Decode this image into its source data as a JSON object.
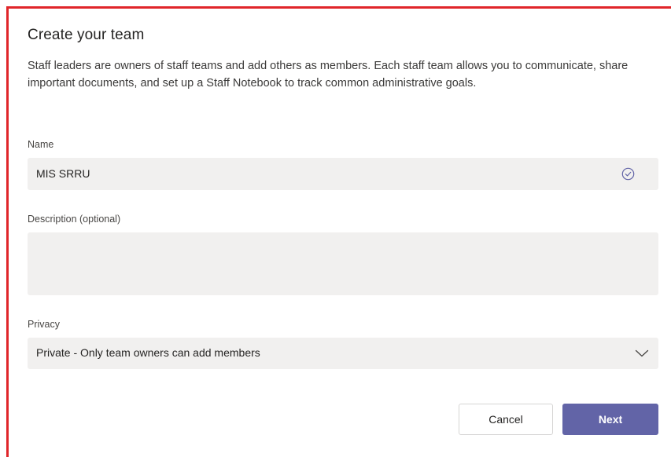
{
  "dialog": {
    "title": "Create your team",
    "description": "Staff leaders are owners of staff teams and add others as members. Each staff team allows you to communicate, share important documents, and set up a Staff Notebook to track common administrative goals."
  },
  "name_field": {
    "label": "Name",
    "value": "MIS SRRU",
    "status_icon": "check-circle-icon"
  },
  "description_field": {
    "label": "Description (optional)",
    "value": ""
  },
  "privacy_field": {
    "label": "Privacy",
    "selected": "Private - Only team owners can add members",
    "icon": "chevron-down-icon"
  },
  "buttons": {
    "cancel_label": "Cancel",
    "next_label": "Next"
  },
  "colors": {
    "accent": "#6264a7",
    "field_background": "#f1f0ef",
    "frame_border": "#e0252a"
  }
}
